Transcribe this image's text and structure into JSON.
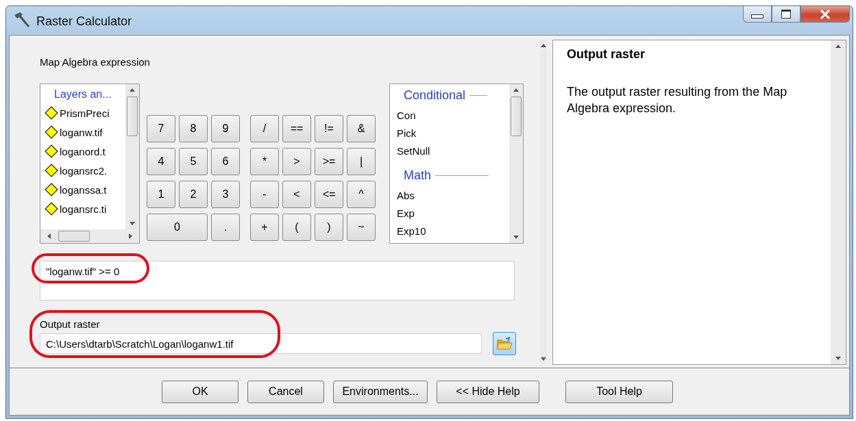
{
  "window": {
    "title": "Raster Calculator"
  },
  "expression_label": "Map Algebra expression",
  "layers": {
    "header": "Layers an...",
    "items": [
      {
        "label": "PrismPreci"
      },
      {
        "label": "loganw.tif"
      },
      {
        "label": "loganord.t"
      },
      {
        "label": "logansrc2."
      },
      {
        "label": "loganssa.t"
      },
      {
        "label": "logansrc.ti"
      }
    ]
  },
  "keys": [
    {
      "label": "7",
      "kind": "normal"
    },
    {
      "label": "8",
      "kind": "normal"
    },
    {
      "label": "9",
      "kind": "normal"
    },
    {
      "label": "/",
      "kind": "normal"
    },
    {
      "label": "==",
      "kind": "normal"
    },
    {
      "label": "!=",
      "kind": "normal"
    },
    {
      "label": "&",
      "kind": "normal"
    },
    {
      "label": "4",
      "kind": "normal"
    },
    {
      "label": "5",
      "kind": "normal"
    },
    {
      "label": "6",
      "kind": "normal"
    },
    {
      "label": "*",
      "kind": "normal"
    },
    {
      "label": ">",
      "kind": "normal"
    },
    {
      "label": ">=",
      "kind": "normal"
    },
    {
      "label": "|",
      "kind": "normal"
    },
    {
      "label": "1",
      "kind": "normal"
    },
    {
      "label": "2",
      "kind": "normal"
    },
    {
      "label": "3",
      "kind": "normal"
    },
    {
      "label": "-",
      "kind": "normal"
    },
    {
      "label": "<",
      "kind": "normal"
    },
    {
      "label": "<=",
      "kind": "normal"
    },
    {
      "label": "^",
      "kind": "normal"
    },
    {
      "label": "0",
      "kind": "wide"
    },
    {
      "label": ".",
      "kind": "normal"
    },
    {
      "label": "+",
      "kind": "normal"
    },
    {
      "label": "(",
      "kind": "normal"
    },
    {
      "label": ")",
      "kind": "normal"
    },
    {
      "label": "~",
      "kind": "normal"
    }
  ],
  "functions": [
    {
      "group": "Conditional",
      "items": [
        "Con",
        "Pick",
        "SetNull"
      ]
    },
    {
      "group": "Math",
      "items": [
        "Abs",
        "Exp",
        "Exp10"
      ]
    }
  ],
  "expression": {
    "value": "\"loganw.tif\" >= 0",
    "circled": true
  },
  "output": {
    "label": "Output raster",
    "value": "C:\\Users\\dtarb\\Scratch\\Logan\\loganw1.tif",
    "circled": true
  },
  "help": {
    "title": "Output raster",
    "text": "The output raster resulting from the Map Algebra expression."
  },
  "buttons": [
    {
      "label": "OK",
      "kind": "ok"
    },
    {
      "label": "Cancel",
      "kind": "normal"
    },
    {
      "label": "Environments...",
      "kind": "normal"
    },
    {
      "label": "<< Hide Help",
      "kind": "normal"
    },
    {
      "label": "Tool Help",
      "kind": "tool"
    }
  ]
}
